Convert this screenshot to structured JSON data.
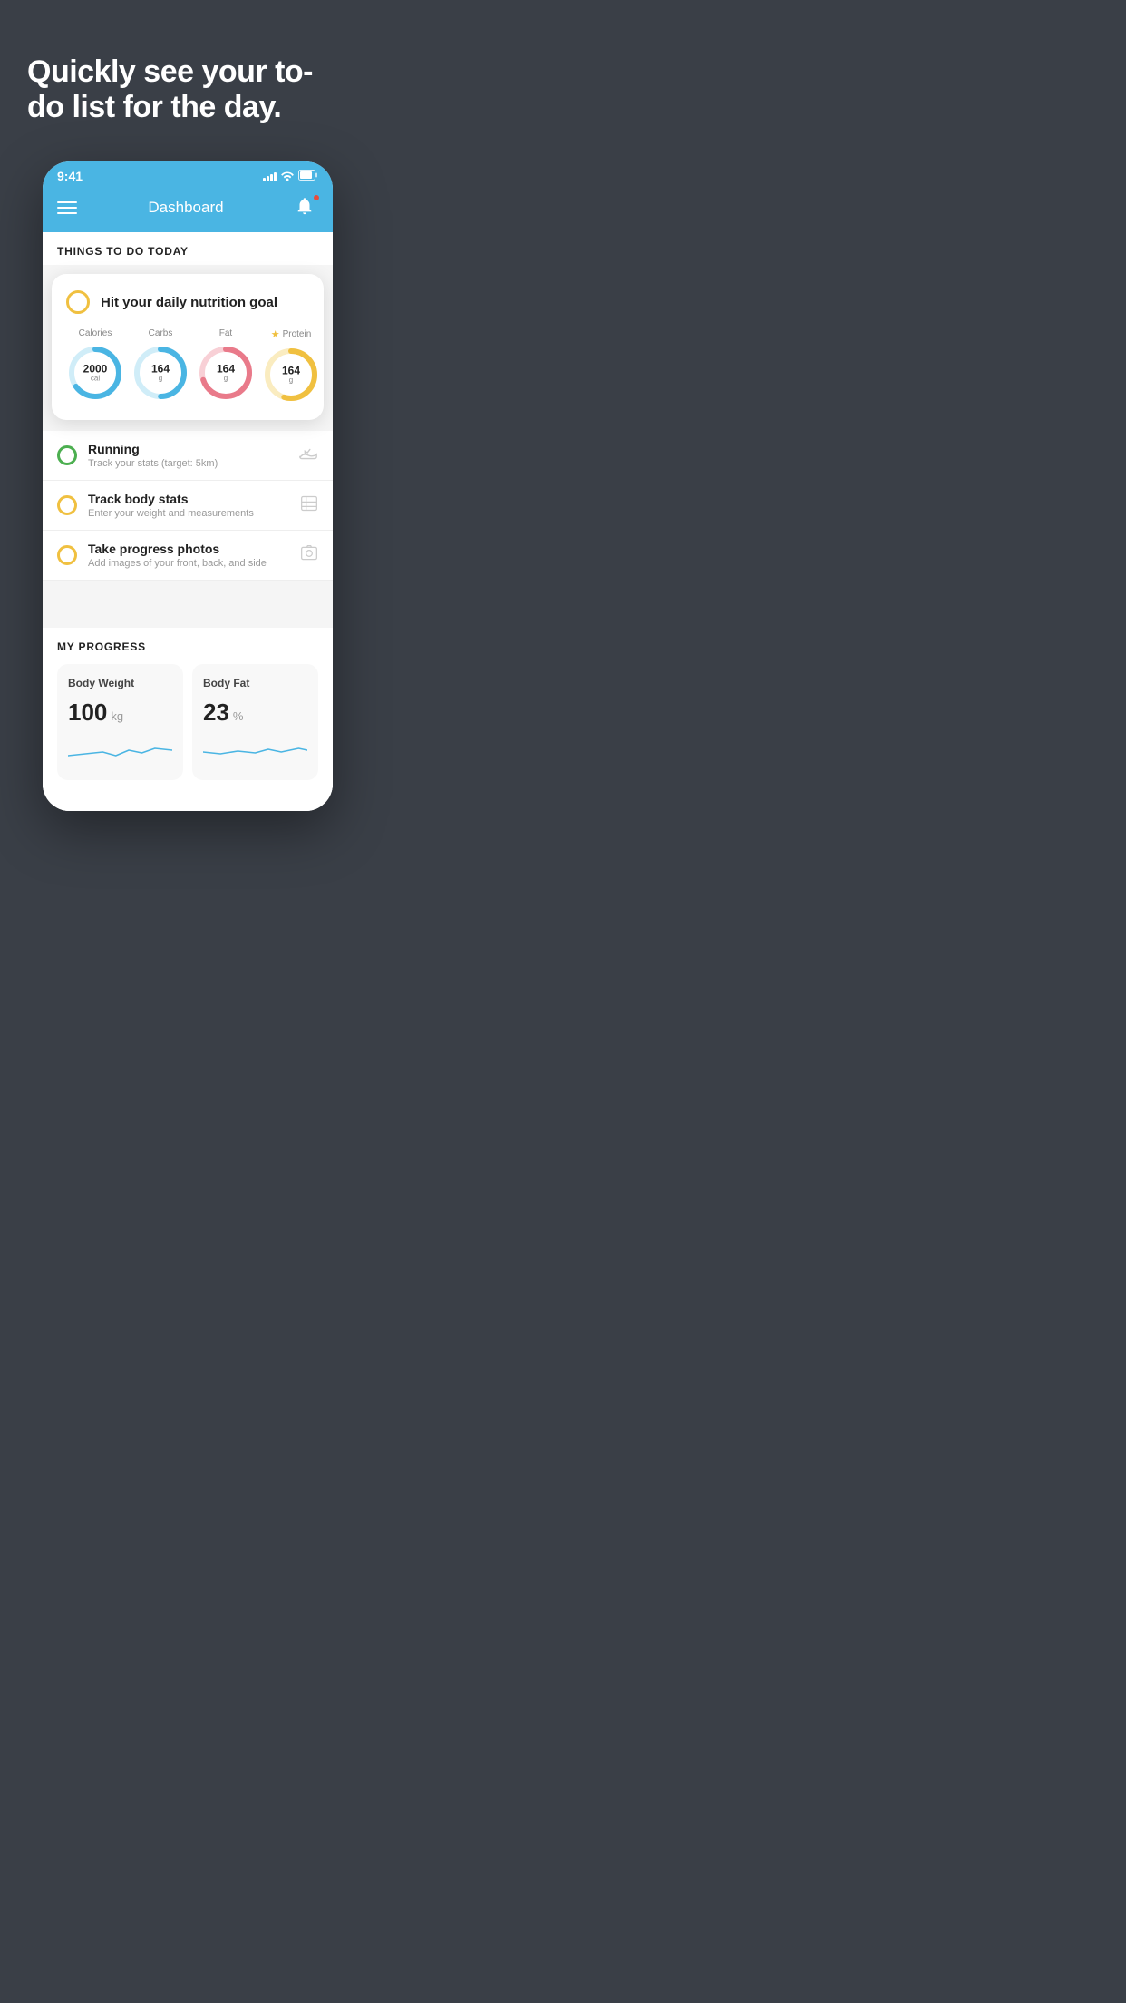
{
  "hero": {
    "title": "Quickly see your to-do list for the day."
  },
  "statusBar": {
    "time": "9:41",
    "signalBars": [
      4,
      6,
      8,
      10,
      12
    ],
    "wifi": "wifi",
    "battery": "battery"
  },
  "navBar": {
    "title": "Dashboard",
    "menuIcon": "hamburger-icon",
    "bellIcon": "bell-icon",
    "notificationDot": true
  },
  "thingsToDoSection": {
    "header": "THINGS TO DO TODAY"
  },
  "nutritionCard": {
    "circleColor": "#f0c040",
    "title": "Hit your daily nutrition goal",
    "items": [
      {
        "label": "Calories",
        "value": "2000",
        "unit": "cal",
        "color": "#4ab5e3",
        "trackColor": "#d0edf8",
        "progress": 0.65,
        "star": false
      },
      {
        "label": "Carbs",
        "value": "164",
        "unit": "g",
        "color": "#4ab5e3",
        "trackColor": "#d0edf8",
        "progress": 0.5,
        "star": false
      },
      {
        "label": "Fat",
        "value": "164",
        "unit": "g",
        "color": "#e97a8a",
        "trackColor": "#f8d0d6",
        "progress": 0.7,
        "star": false
      },
      {
        "label": "Protein",
        "value": "164",
        "unit": "g",
        "color": "#f0c040",
        "trackColor": "#faecc0",
        "progress": 0.55,
        "star": true
      }
    ]
  },
  "todoItems": [
    {
      "id": "running",
      "title": "Running",
      "subtitle": "Track your stats (target: 5km)",
      "circleColor": "green",
      "icon": "shoe-icon"
    },
    {
      "id": "track-body",
      "title": "Track body stats",
      "subtitle": "Enter your weight and measurements",
      "circleColor": "yellow",
      "icon": "scale-icon"
    },
    {
      "id": "progress-photos",
      "title": "Take progress photos",
      "subtitle": "Add images of your front, back, and side",
      "circleColor": "yellow",
      "icon": "photo-icon"
    }
  ],
  "myProgress": {
    "header": "MY PROGRESS",
    "cards": [
      {
        "title": "Body Weight",
        "value": "100",
        "unit": "kg"
      },
      {
        "title": "Body Fat",
        "value": "23",
        "unit": "%"
      }
    ]
  }
}
